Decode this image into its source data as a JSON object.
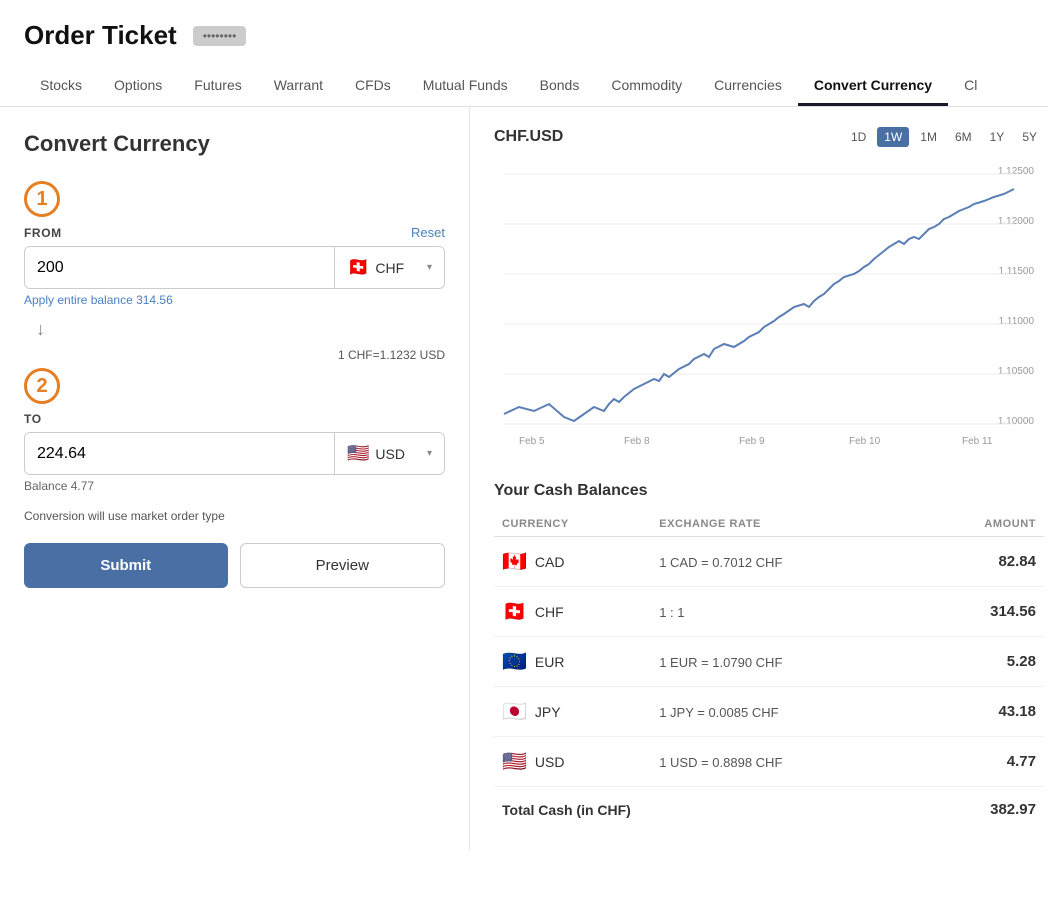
{
  "header": {
    "title": "Order Ticket",
    "account": "••••••••"
  },
  "nav": {
    "tabs": [
      {
        "id": "stocks",
        "label": "Stocks",
        "active": false
      },
      {
        "id": "options",
        "label": "Options",
        "active": false
      },
      {
        "id": "futures",
        "label": "Futures",
        "active": false
      },
      {
        "id": "warrant",
        "label": "Warrant",
        "active": false
      },
      {
        "id": "cfds",
        "label": "CFDs",
        "active": false
      },
      {
        "id": "mutual-funds",
        "label": "Mutual Funds",
        "active": false
      },
      {
        "id": "bonds",
        "label": "Bonds",
        "active": false
      },
      {
        "id": "commodity",
        "label": "Commodity",
        "active": false
      },
      {
        "id": "currencies",
        "label": "Currencies",
        "active": false
      },
      {
        "id": "convert-currency",
        "label": "Convert Currency",
        "active": true
      },
      {
        "id": "cl",
        "label": "Cl",
        "active": false
      }
    ]
  },
  "left_panel": {
    "title": "Convert Currency",
    "step1_label": "1",
    "step2_label": "2",
    "from_label": "FROM",
    "reset_label": "Reset",
    "from_amount": "200",
    "from_currency": "CHF",
    "apply_balance_text": "Apply entire balance 314.56",
    "rate_text": "1 CHF=1.1232 USD",
    "to_label": "TO",
    "to_amount": "224.64",
    "to_currency": "USD",
    "balance_text": "Balance 4.77",
    "conversion_note": "Conversion will use market order type",
    "submit_label": "Submit",
    "preview_label": "Preview"
  },
  "chart": {
    "title": "CHF.USD",
    "time_buttons": [
      "1D",
      "1W",
      "1M",
      "6M",
      "1Y",
      "5Y"
    ],
    "active_time": "1W",
    "x_labels": [
      "Feb 5",
      "Feb 8",
      "Feb 9",
      "Feb 10",
      "Feb 11"
    ],
    "y_labels": [
      "1.12500",
      "1.12000",
      "1.11500",
      "1.11000",
      "1.10500",
      "1.10000"
    ]
  },
  "cash_balances": {
    "title": "Your Cash Balances",
    "column_currency": "CURRENCY",
    "column_exchange": "EXCHANGE RATE",
    "column_amount": "AMOUNT",
    "rows": [
      {
        "flag": "🇨🇦",
        "currency": "CAD",
        "exchange": "1 CAD = 0.7012 CHF",
        "amount": "82.84"
      },
      {
        "flag": "🇨🇭",
        "currency": "CHF",
        "exchange": "1 : 1",
        "amount": "314.56"
      },
      {
        "flag": "🇪🇺",
        "currency": "EUR",
        "exchange": "1 EUR = 1.0790 CHF",
        "amount": "5.28"
      },
      {
        "flag": "🇯🇵",
        "currency": "JPY",
        "exchange": "1 JPY = 0.0085 CHF",
        "amount": "43.18"
      },
      {
        "flag": "🇺🇸",
        "currency": "USD",
        "exchange": "1 USD = 0.8898 CHF",
        "amount": "4.77"
      }
    ],
    "total_label": "Total Cash (in CHF)",
    "total_amount": "382.97"
  }
}
